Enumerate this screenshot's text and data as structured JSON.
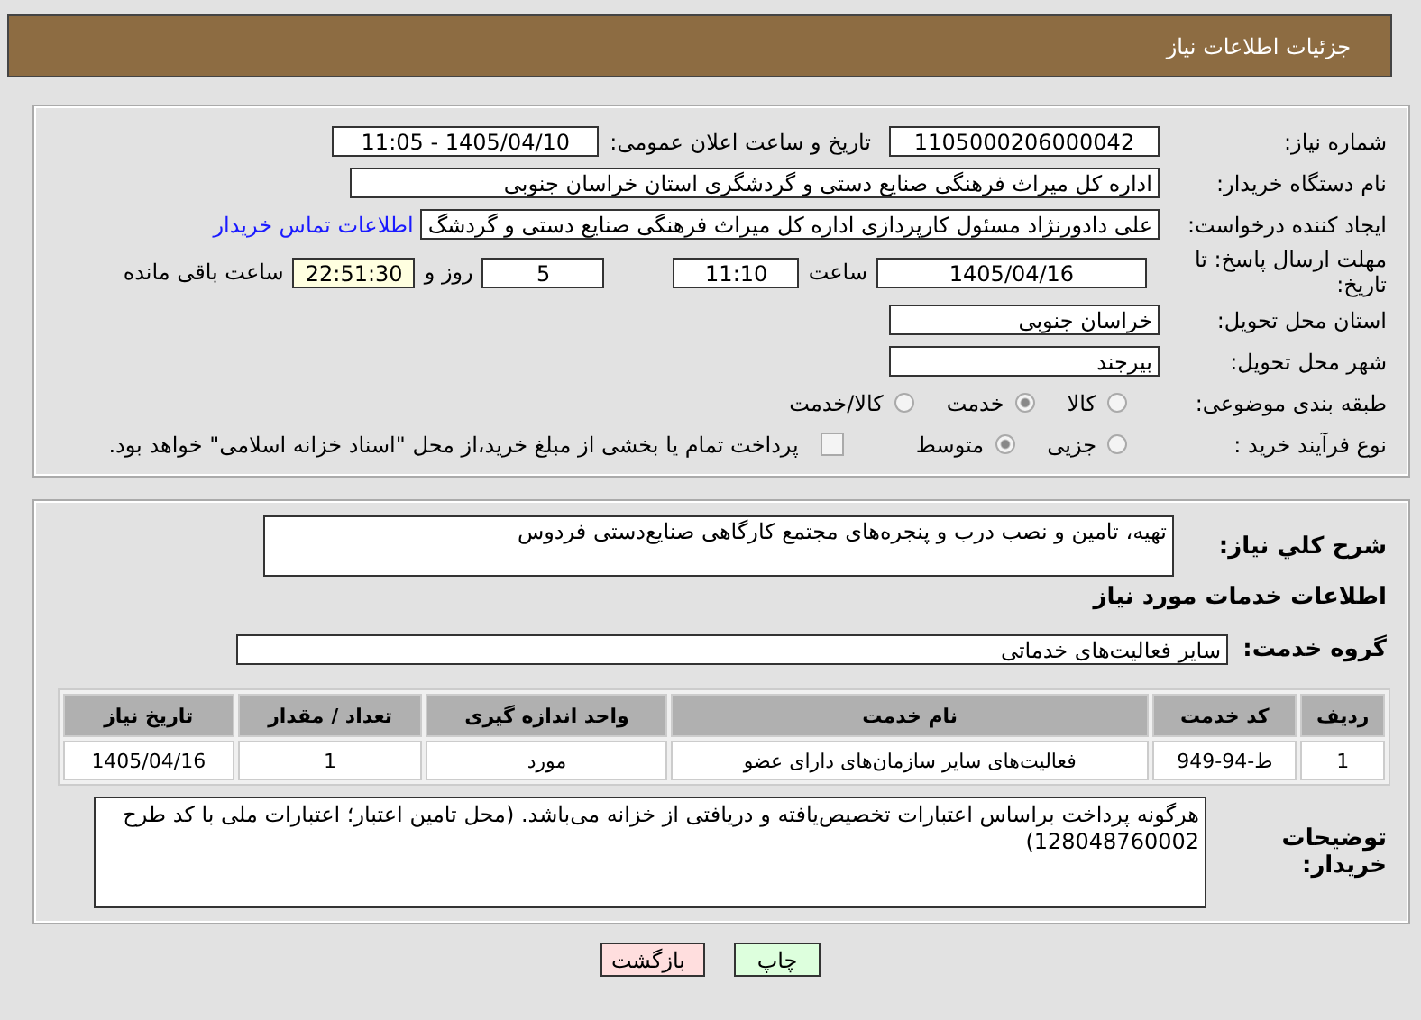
{
  "header": {
    "title": "جزئیات اطلاعات نیاز"
  },
  "details": {
    "need_number": {
      "label": "شماره نیاز:",
      "value": "1105000206000042"
    },
    "announce": {
      "label": "تاریخ و ساعت اعلان عمومی:",
      "value": "1405/04/10 - 11:05"
    },
    "buyer": {
      "label": "نام دستگاه خریدار:",
      "value": "اداره کل میراث فرهنگی  صنایع دستی و گردشگری استان خراسان جنوبی"
    },
    "creator": {
      "label": "ایجاد کننده درخواست:",
      "value": "علی دادورنژاد مسئول کارپردازی اداره کل میراث فرهنگی  صنایع دستی و گردشگ",
      "link": "اطلاعات تماس خریدار"
    },
    "deadline": {
      "label": "مهلت ارسال پاسخ: تا تاریخ:",
      "date": "1405/04/16",
      "time_label": "ساعت",
      "time": "11:10",
      "days": "5",
      "days_label": "روز و",
      "remaining": "22:51:30",
      "remaining_label": "ساعت باقی مانده"
    },
    "province": {
      "label": "استان محل تحویل:",
      "value": "خراسان جنوبی"
    },
    "city": {
      "label": "شهر محل تحویل:",
      "value": "بیرجند"
    },
    "category": {
      "label": "طبقه بندی موضوعی:",
      "options": [
        {
          "label": "کالا",
          "selected": false
        },
        {
          "label": "خدمت",
          "selected": true
        },
        {
          "label": "کالا/خدمت",
          "selected": false
        }
      ]
    },
    "process": {
      "label": "نوع فرآیند خرید :",
      "options": [
        {
          "label": "جزیی",
          "selected": false
        },
        {
          "label": "متوسط",
          "selected": true
        }
      ],
      "payment": {
        "checked": false,
        "text": "پرداخت تمام یا بخشی از مبلغ خرید،از محل \"اسناد خزانه اسلامی\" خواهد بود."
      }
    }
  },
  "summary": {
    "label": "شرح کلي نياز:",
    "value": "تهیه، تامین و نصب درب و پنجره‌های مجتمع کارگاهی صنایع‌دستی فردوس"
  },
  "services_title": "اطلاعات خدمات مورد نیاز",
  "service_group": {
    "label": "گروه خدمت:",
    "value": "سایر فعالیت‌های خدماتی"
  },
  "table": {
    "columns": [
      "ردیف",
      "کد خدمت",
      "نام خدمت",
      "واحد اندازه گیری",
      "تعداد / مقدار",
      "تاریخ نیاز"
    ],
    "rows": [
      [
        "1",
        "ط-94-949",
        "فعالیت‌های سایر سازمان‌های دارای عضو",
        "مورد",
        "1",
        "1405/04/16"
      ]
    ]
  },
  "notes": {
    "label": "توضیحات خریدار:",
    "value": "هرگونه پرداخت براساس اعتبارات تخصیص‌یافته و دریافتی از خزانه می‌باشد. (محل تامین اعتبار؛ اعتبارات ملی با کد طرح 128048760002)"
  },
  "buttons": [
    {
      "label": "چاپ",
      "kind": "print"
    },
    {
      "label": "بازگشت",
      "kind": "back"
    }
  ]
}
